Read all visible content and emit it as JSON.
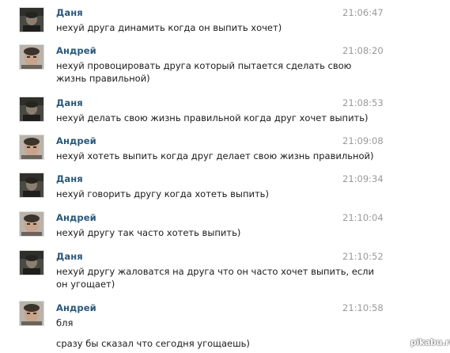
{
  "messages": [
    {
      "author": "Даня",
      "time": "21:06:47",
      "avatar": "avatar-dark-icon",
      "lines": [
        "нехуй друга динамить когда он выпить хочет)"
      ]
    },
    {
      "author": "Андрей",
      "time": "21:08:20",
      "avatar": "avatar-light-icon",
      "lines": [
        "нехуй провоцировать друга который  пытается сделать свою",
        "жизнь правильной)"
      ]
    },
    {
      "author": "Даня",
      "time": "21:08:53",
      "avatar": "avatar-dark-icon",
      "lines": [
        "нехуй делать свою жизнь правильной когда друг хочет выпить)"
      ]
    },
    {
      "author": "Андрей",
      "time": "21:09:08",
      "avatar": "avatar-light-icon",
      "lines": [
        "нехуй хотеть выпить когда друг делает свою жизнь правильной)"
      ]
    },
    {
      "author": "Даня",
      "time": "21:09:34",
      "avatar": "avatar-dark-icon",
      "lines": [
        "нехуй говорить другу когда хотеть выпить)"
      ]
    },
    {
      "author": "Андрей",
      "time": "21:10:04",
      "avatar": "avatar-light-icon",
      "lines": [
        "нехуй другу так часто хотеть выпить)"
      ]
    },
    {
      "author": "Даня",
      "time": "21:10:52",
      "avatar": "avatar-dark-icon",
      "lines": [
        "нехуй другу жаловатся на друга что он часто хочет выпить, если",
        "он угощает)"
      ]
    },
    {
      "author": "Андрей",
      "time": "21:10:58",
      "avatar": "avatar-light-icon",
      "lines": [
        "бля",
        "",
        "сразу бы сказал что сегодня угощаешь)"
      ]
    }
  ],
  "watermark": "pikabu.ru",
  "colors": {
    "author": "#2b587a",
    "time": "#9a9a9a",
    "text": "#1a1a1a"
  }
}
